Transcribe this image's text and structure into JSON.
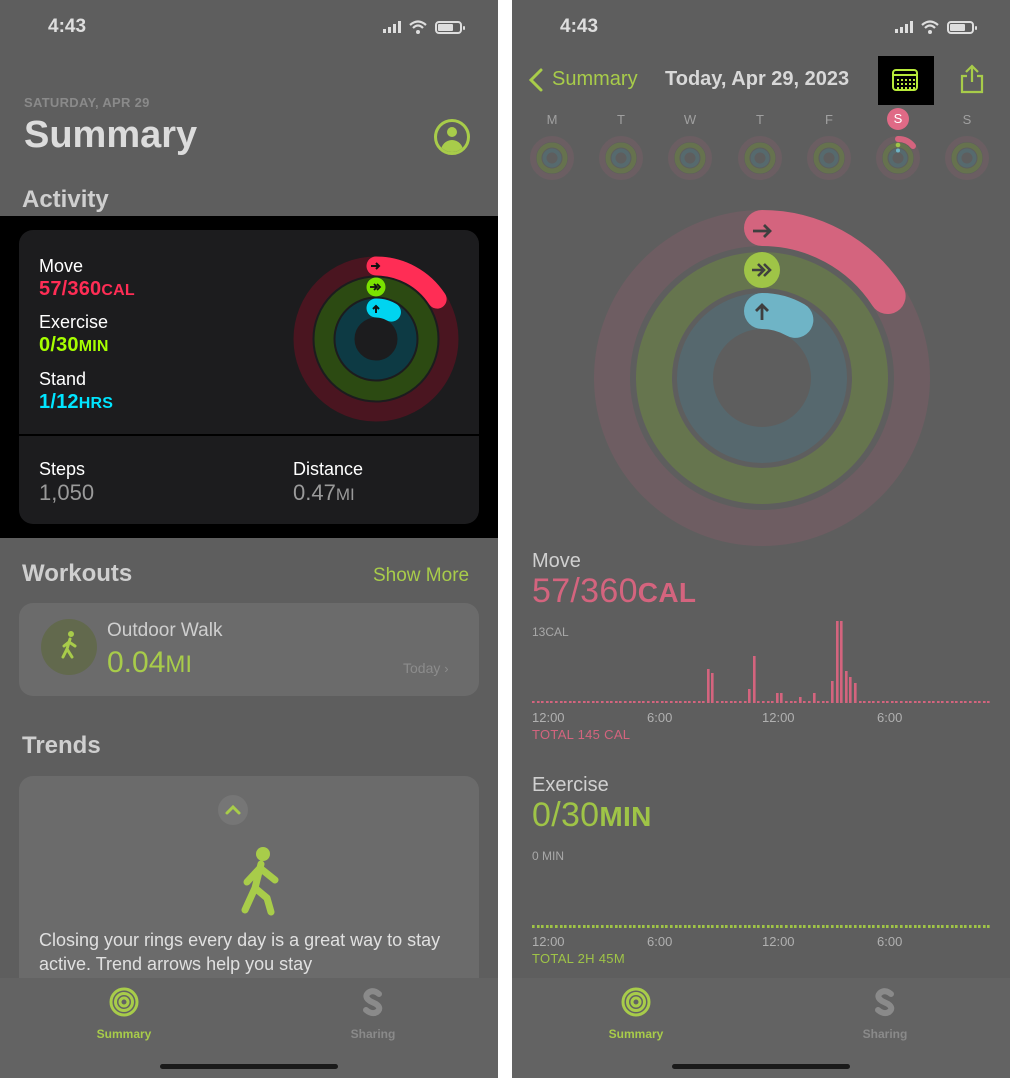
{
  "left": {
    "status": {
      "time": "4:43"
    },
    "header": {
      "date": "SATURDAY, APR 29",
      "title": "Summary"
    },
    "activity": {
      "section_title": "Activity",
      "move": {
        "label": "Move",
        "value": "57/360",
        "unit": "CAL",
        "progress": 0.158
      },
      "exercise": {
        "label": "Exercise",
        "value": "0/30",
        "unit": "MIN",
        "progress": 0.0
      },
      "stand": {
        "label": "Stand",
        "value": "1/12",
        "unit": "HRS",
        "progress": 0.083
      },
      "steps": {
        "label": "Steps",
        "value": "1,050"
      },
      "distance": {
        "label": "Distance",
        "value": "0.47",
        "unit": "MI"
      }
    },
    "workouts": {
      "section_title": "Workouts",
      "show_more": "Show More",
      "item": {
        "title": "Outdoor Walk",
        "value": "0.04",
        "unit": "MI",
        "date": "Today"
      }
    },
    "trends": {
      "section_title": "Trends",
      "text": "Closing your rings every day is a great way to stay active. Trend arrows help you stay"
    },
    "tabbar": {
      "summary": "Summary",
      "sharing": "Sharing"
    }
  },
  "right": {
    "status": {
      "time": "4:43"
    },
    "nav": {
      "back": "Summary",
      "title": "Today, Apr 29, 2023"
    },
    "week": {
      "days": [
        "M",
        "T",
        "W",
        "T",
        "F",
        "S",
        "S"
      ],
      "selected_index": 5
    },
    "move": {
      "label": "Move",
      "value": "57/360",
      "unit": "CAL",
      "axis_max": "13CAL",
      "ticks": [
        "12:00",
        "6:00",
        "12:00",
        "6:00"
      ],
      "total": "TOTAL 145 CAL"
    },
    "exercise": {
      "label": "Exercise",
      "value": "0/30",
      "unit": "MIN",
      "axis_max": "0 MIN",
      "ticks": [
        "12:00",
        "6:00",
        "12:00",
        "6:00"
      ],
      "total": "TOTAL 2H 45M"
    },
    "tabbar": {
      "summary": "Summary",
      "sharing": "Sharing"
    }
  },
  "colors": {
    "move": "#ff2d55",
    "exercise": "#a6ff00",
    "stand": "#00e5ff",
    "accent": "#a8cc4a",
    "move_dim": "#d4647e",
    "exercise_dim": "#9fc447"
  }
}
